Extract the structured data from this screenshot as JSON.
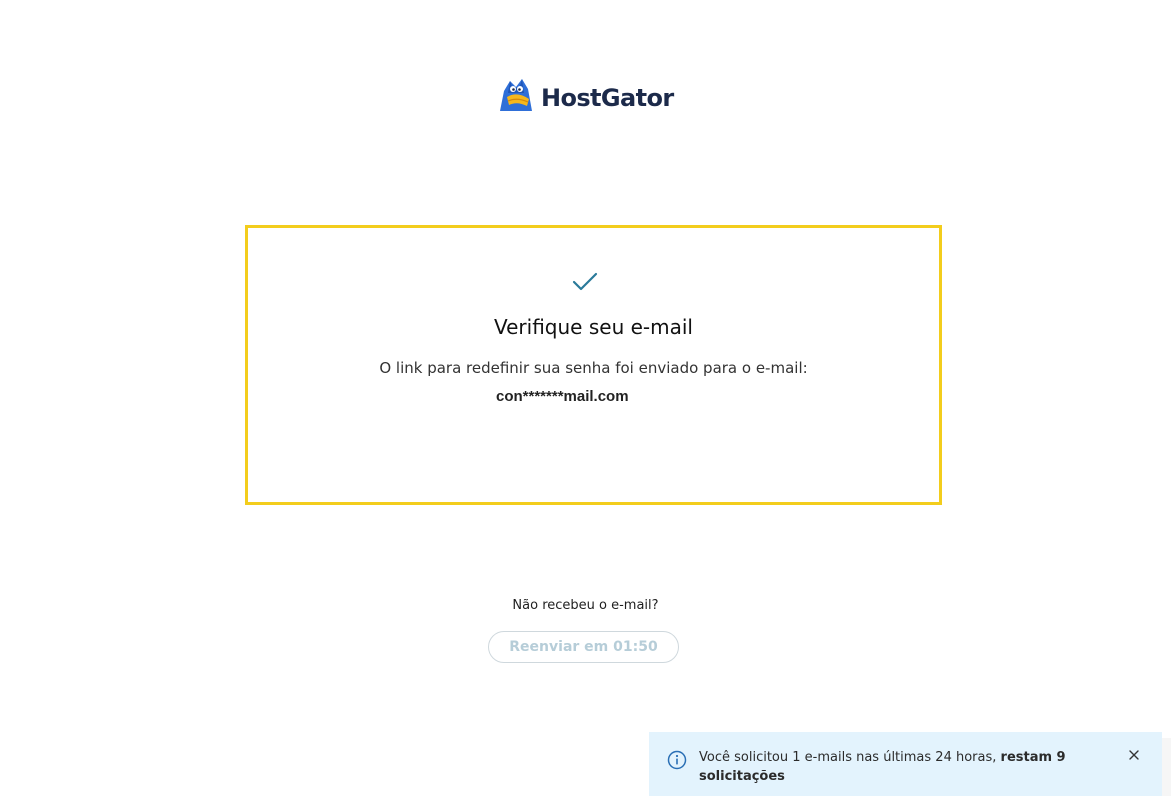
{
  "brand": {
    "name": "HostGator",
    "logo_icon": "gator-mascot-icon",
    "text_color": "#1c2a4a"
  },
  "card": {
    "check_icon": "check-icon",
    "title": "Verifique seu e-mail",
    "description": "O link para redefinir sua senha foi enviado para o e-mail:",
    "email": "con*******mail.com",
    "border_color": "#f3cd1c",
    "check_color": "#2a7a9a"
  },
  "resend": {
    "question": "Não recebeu o e-mail?",
    "button_label": "Reenviar em 01:50",
    "button_text_color": "#b6cdd8"
  },
  "toast": {
    "icon": "info-icon",
    "message": "Você solicitou 1 e-mails nas últimas 24 horas, ",
    "message_bold": "restam 9 solicitações",
    "close_icon": "close-icon",
    "background": "#e3f3fd"
  }
}
